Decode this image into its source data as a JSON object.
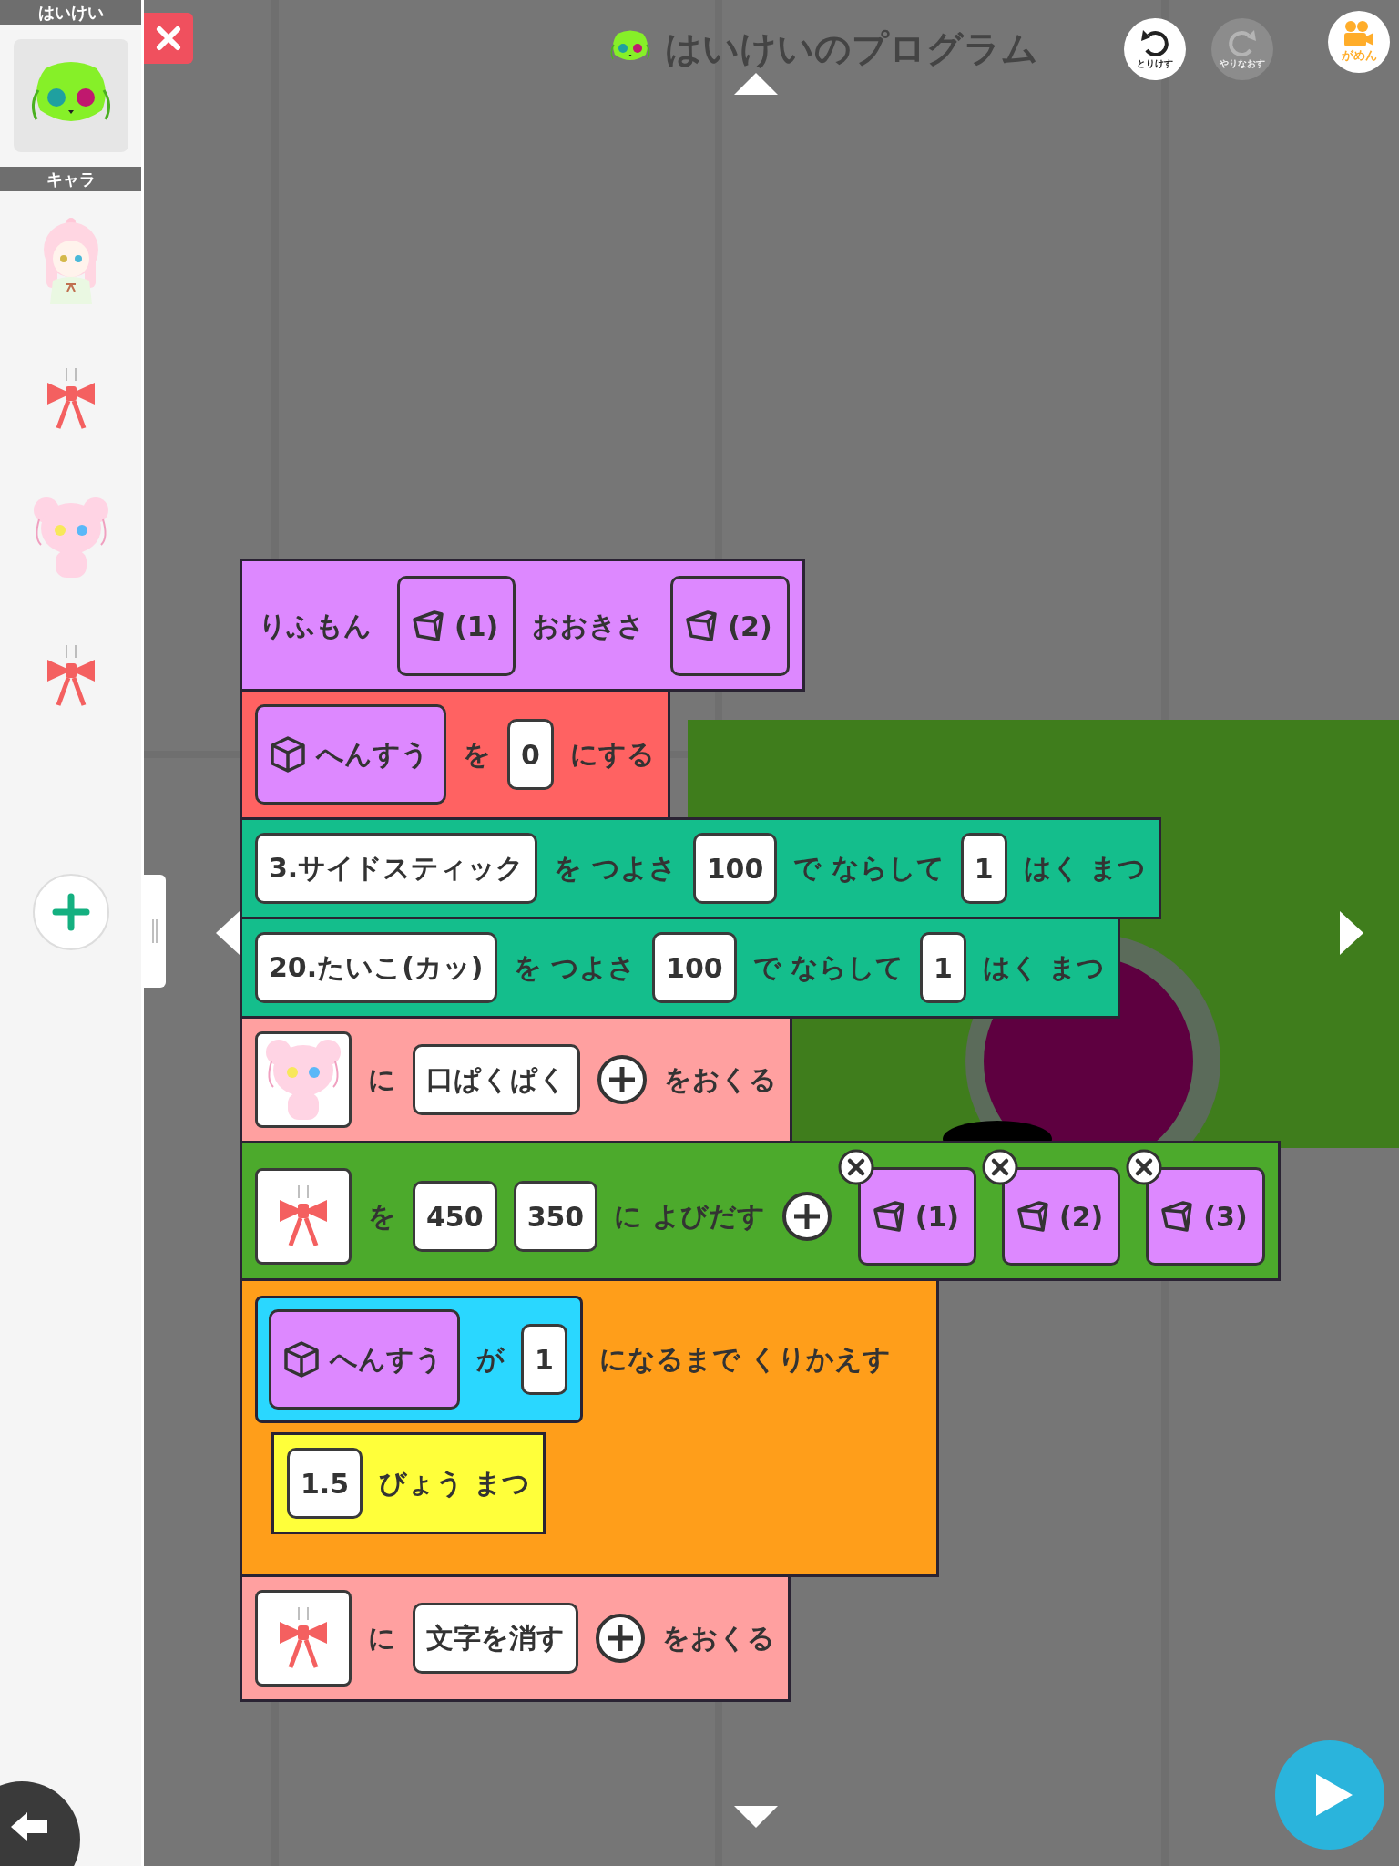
{
  "sidebar": {
    "background_header": "はいけい",
    "background": {
      "kind": "cabbage",
      "selected": true
    },
    "character_header": "キャラ",
    "characters": [
      {
        "kind": "girl"
      },
      {
        "kind": "ribbon"
      },
      {
        "kind": "bear"
      },
      {
        "kind": "ribbon"
      }
    ]
  },
  "title": "はいけいのプログラム",
  "toolbar": [
    {
      "kind": "undo",
      "label": "とりけす",
      "disabled": false
    },
    {
      "kind": "redo",
      "label": "やりなおす",
      "disabled": true
    },
    {
      "kind": "screen",
      "label": "がめん",
      "disabled": false
    }
  ],
  "blocks": [
    {
      "kind": "define",
      "parts": [
        {
          "kind": "text",
          "text": "りふもん"
        },
        {
          "kind": "param",
          "text": "(1)",
          "removable": false
        },
        {
          "kind": "text",
          "text": "おおきさ"
        },
        {
          "kind": "param",
          "text": "(2)",
          "removable": false
        }
      ]
    },
    {
      "kind": "set",
      "parts": [
        {
          "kind": "var",
          "text": "へんすう"
        },
        {
          "kind": "text",
          "text": "を"
        },
        {
          "kind": "field",
          "text": "0"
        },
        {
          "kind": "text",
          "text": "にする"
        }
      ]
    },
    {
      "kind": "sound",
      "parts": [
        {
          "kind": "field",
          "text": "3.サイドスティック"
        },
        {
          "kind": "text",
          "text": "を つよさ"
        },
        {
          "kind": "field",
          "text": "100"
        },
        {
          "kind": "text",
          "text": "で ならして"
        },
        {
          "kind": "field",
          "text": "1"
        },
        {
          "kind": "text",
          "text": "はく まつ"
        }
      ]
    },
    {
      "kind": "sound",
      "parts": [
        {
          "kind": "field",
          "text": "20.たいこ(カッ)"
        },
        {
          "kind": "text",
          "text": "を つよさ"
        },
        {
          "kind": "field",
          "text": "100"
        },
        {
          "kind": "text",
          "text": "で ならして"
        },
        {
          "kind": "field",
          "text": "1"
        },
        {
          "kind": "text",
          "text": "はく まつ"
        }
      ]
    },
    {
      "kind": "message",
      "parts": [
        {
          "kind": "char",
          "art": {
            "kind": "bear"
          }
        },
        {
          "kind": "text",
          "text": "に"
        },
        {
          "kind": "field",
          "text": "口ぱくぱく"
        },
        {
          "kind": "plus"
        },
        {
          "kind": "text",
          "text": "をおくる"
        }
      ]
    },
    {
      "kind": "spawn",
      "parts": [
        {
          "kind": "char",
          "art": {
            "kind": "ribbon"
          }
        },
        {
          "kind": "text",
          "text": "を"
        },
        {
          "kind": "field",
          "text": "450"
        },
        {
          "kind": "field",
          "text": "350"
        },
        {
          "kind": "text",
          "text": "に よびだす"
        },
        {
          "kind": "plus"
        },
        {
          "kind": "param",
          "text": "(1)",
          "removable": true
        },
        {
          "kind": "param",
          "text": "(2)",
          "removable": true
        },
        {
          "kind": "param",
          "text": "(3)",
          "removable": true
        }
      ]
    },
    {
      "kind": "repeat",
      "parts": [
        {
          "kind": "condition",
          "parts": [
            {
              "kind": "var",
              "text": "へんすう"
            },
            {
              "kind": "text",
              "text": "が"
            },
            {
              "kind": "field",
              "text": "1"
            }
          ]
        },
        {
          "kind": "text",
          "text": "になるまで くりかえす"
        }
      ],
      "children": [
        {
          "kind": "wait",
          "parts": [
            {
              "kind": "field",
              "text": "1.5"
            },
            {
              "kind": "text",
              "text": "びょう まつ"
            }
          ]
        }
      ]
    },
    {
      "kind": "message",
      "parts": [
        {
          "kind": "char",
          "art": {
            "kind": "ribbon"
          }
        },
        {
          "kind": "text",
          "text": "に"
        },
        {
          "kind": "field",
          "text": "文字を消す"
        },
        {
          "kind": "plus"
        },
        {
          "kind": "text",
          "text": "をおくる"
        }
      ]
    }
  ]
}
